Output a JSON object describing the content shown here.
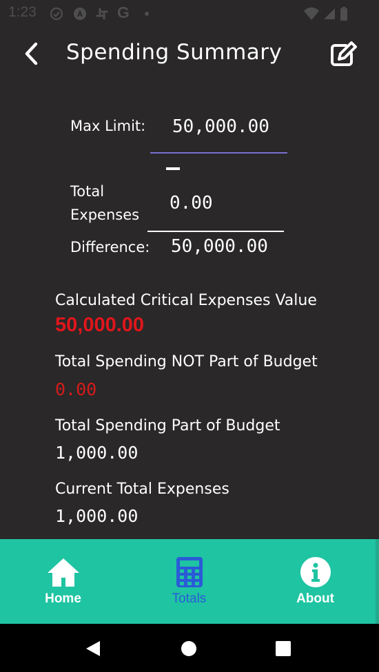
{
  "status_bar": {
    "time": "1:23"
  },
  "app_bar": {
    "title": "Spending Summary"
  },
  "form": {
    "max_limit_label": "Max Limit:",
    "max_limit_value": "50,000.00",
    "minus_symbol": "-",
    "total_expenses_label_line1": "Total",
    "total_expenses_label_line2": "Expenses",
    "total_expenses_value": "0.00",
    "difference_label": "Difference:",
    "difference_value": "50,000.00"
  },
  "summary": {
    "critical_label": "Calculated Critical Expenses Value",
    "critical_value": "50,000.00",
    "not_budget_label": "Total Spending NOT Part of Budget",
    "not_budget_value": "0.00",
    "part_budget_label": "Total Spending Part of Budget",
    "part_budget_value": "1,000.00",
    "current_total_label": "Current Total Expenses",
    "current_total_value": "1,000.00"
  },
  "bottom_nav": {
    "items": [
      {
        "label": "Home",
        "icon": "home-icon"
      },
      {
        "label": "Totals",
        "icon": "calculator-icon",
        "active": true
      },
      {
        "label": "About",
        "icon": "info-icon"
      }
    ]
  },
  "colors": {
    "background": "#2a2829",
    "accent": "#1fc4a2",
    "active_nav": "#2a5bd7",
    "critical_red": "#e0161c",
    "underline": "#7a6fd3"
  }
}
